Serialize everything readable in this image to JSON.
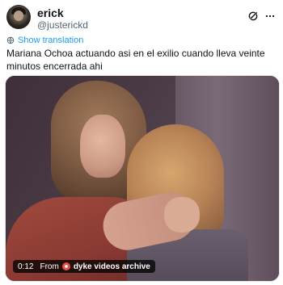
{
  "post": {
    "author_name": "erick",
    "author_handle": "@justerickd",
    "show_translation": "Show translation",
    "text": "Mariana Ochoa actuando asi en el exilio cuando lleva veinte minutos encerrada ahi"
  },
  "media": {
    "time": "0:12",
    "from_label": "From",
    "source_name": "dyke videos archive"
  },
  "icons": {
    "grok": "grok-icon",
    "more": "more-icon",
    "translate": "translate-icon"
  },
  "colors": {
    "link": "#1d9bf0",
    "secondary_text": "#536471",
    "text": "#0f1419"
  }
}
